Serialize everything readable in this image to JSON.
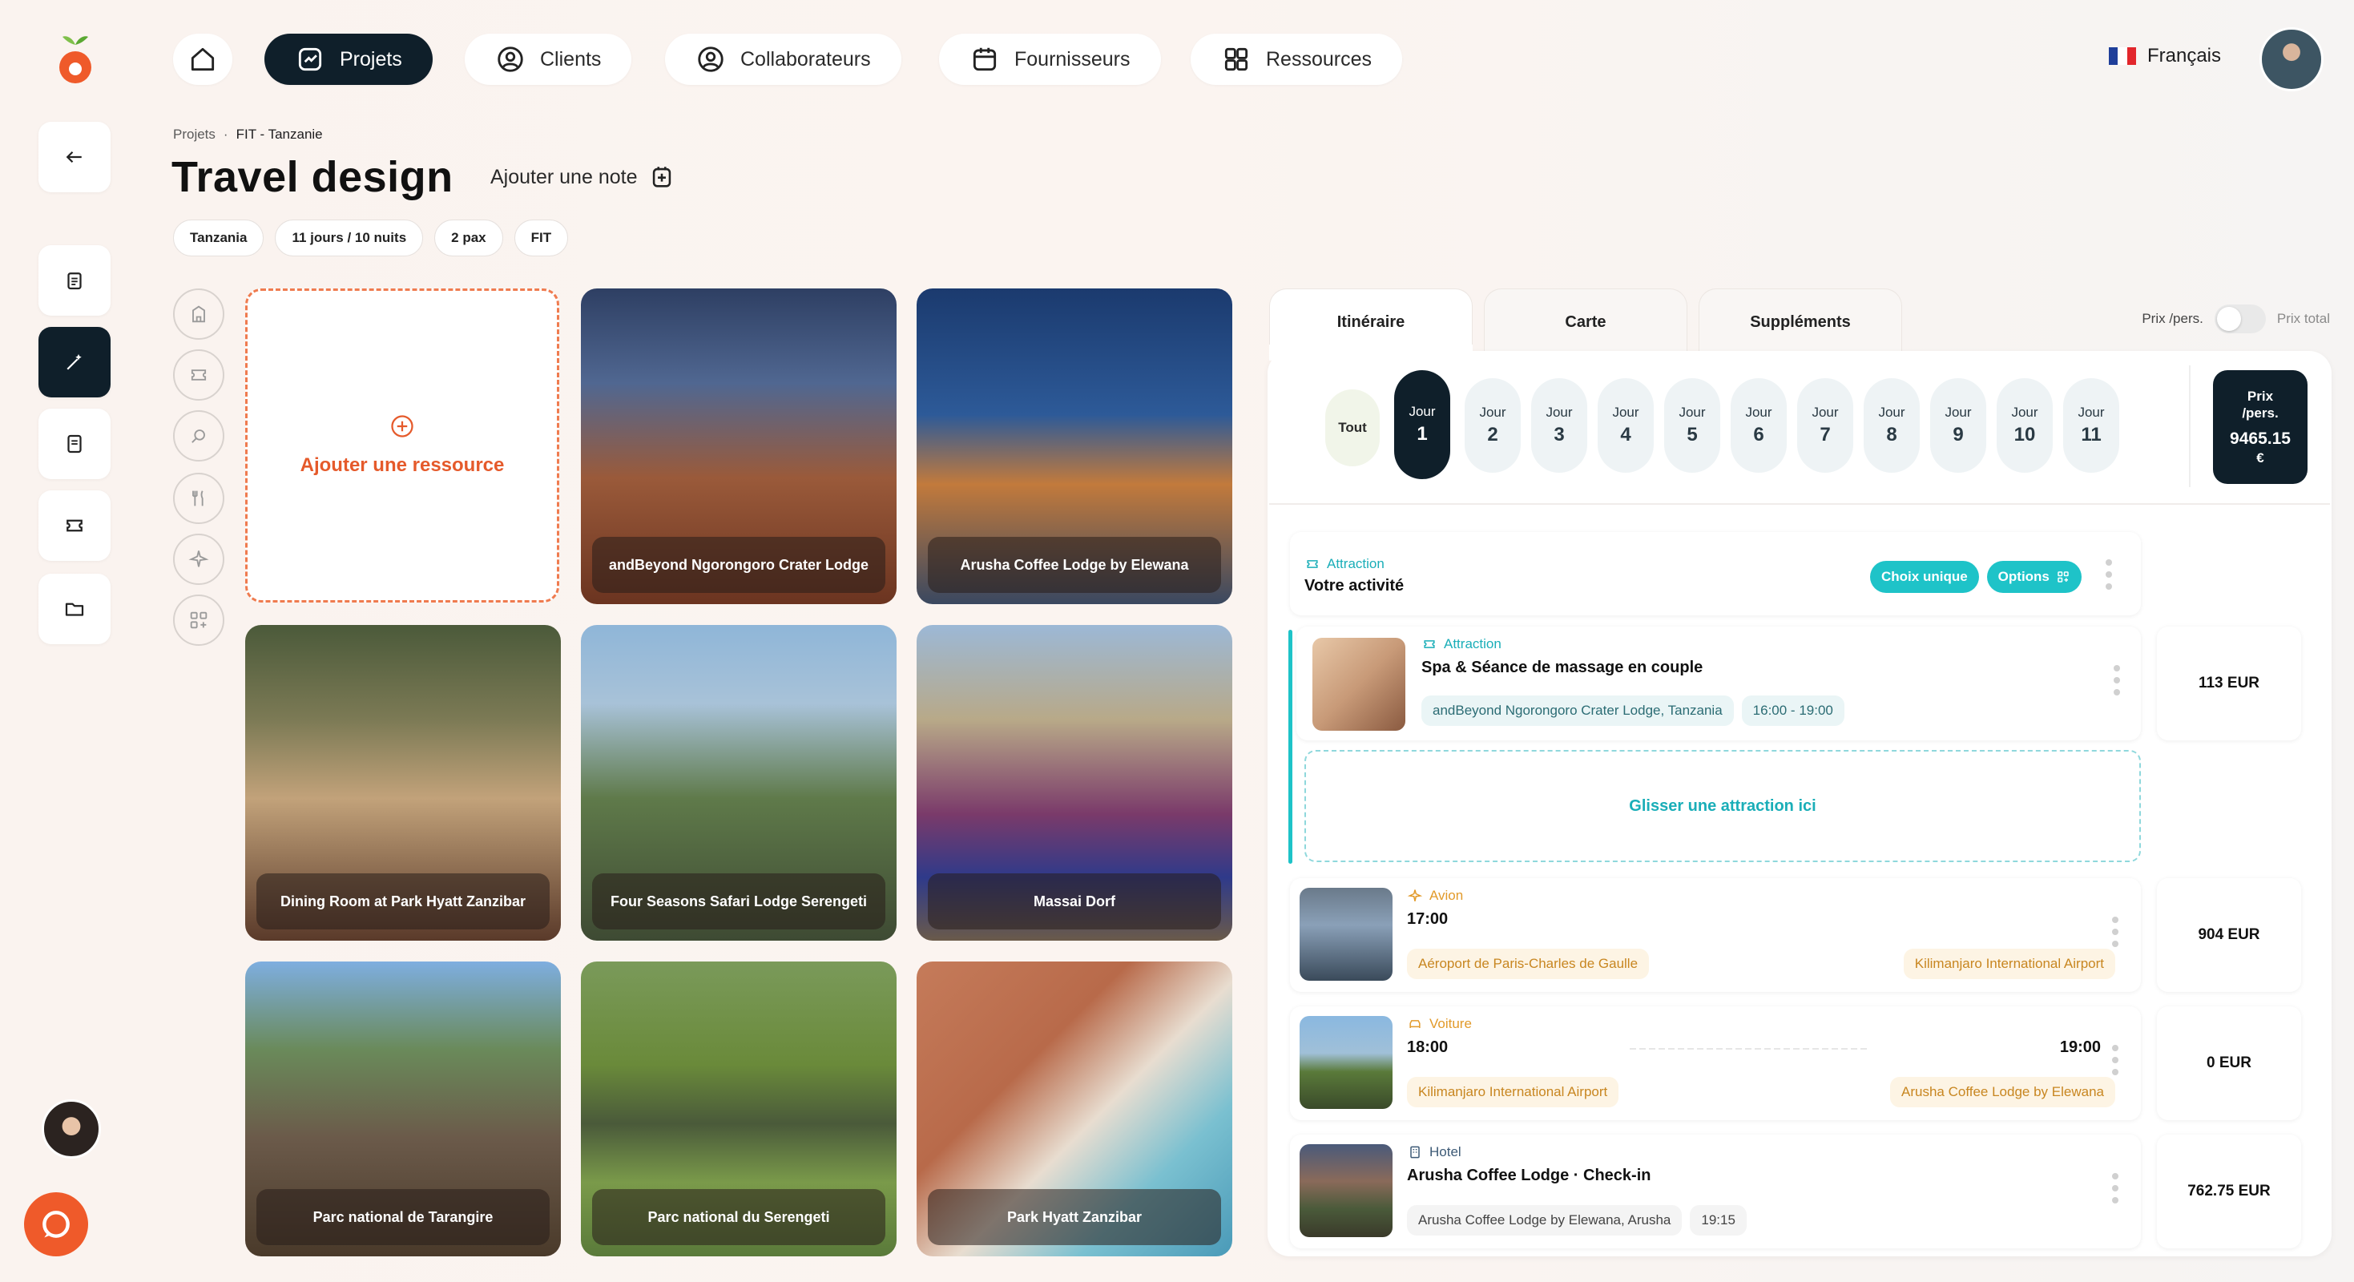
{
  "nav": {
    "items": [
      {
        "label": "Projets",
        "icon": "projects-icon",
        "active": true
      },
      {
        "label": "Clients",
        "icon": "user-circle-icon",
        "active": false
      },
      {
        "label": "Collaborateurs",
        "icon": "user-circle-icon",
        "active": false
      },
      {
        "label": "Fournisseurs",
        "icon": "calendar-icon",
        "active": false
      },
      {
        "label": "Ressources",
        "icon": "grid-icon",
        "active": false
      }
    ],
    "language": "Français"
  },
  "breadcrumb": {
    "root": "Projets",
    "separator": "·",
    "current": "FIT - Tanzanie"
  },
  "page": {
    "title": "Travel design",
    "add_note": "Ajouter une note",
    "tags": [
      "Tanzania",
      "11 jours / 10 nuits",
      "2 pax",
      "FIT"
    ]
  },
  "resources": {
    "add_label": "Ajouter une ressource",
    "cards": [
      "andBeyond Ngorongoro Crater Lodge",
      "Arusha Coffee Lodge by Elewana",
      "Dining Room at Park Hyatt Zanzibar",
      "Four Seasons Safari Lodge Serengeti",
      "Massai Dorf",
      "Parc national de Tarangire",
      "Parc national du Serengeti",
      "Park Hyatt Zanzibar"
    ]
  },
  "panel": {
    "tabs": [
      "Itinéraire",
      "Carte",
      "Suppléments"
    ],
    "toggle": {
      "left": "Prix /pers.",
      "right": "Prix total"
    },
    "days": {
      "all": "Tout",
      "day_label": "Jour",
      "numbers": [
        "1",
        "2",
        "3",
        "4",
        "5",
        "6",
        "7",
        "8",
        "9",
        "10",
        "11"
      ]
    },
    "price": {
      "label_1": "Prix",
      "label_2": "/pers.",
      "value": "9465.15",
      "currency": "€"
    },
    "activity": {
      "type": "Attraction",
      "title": "Votre activité",
      "choice_btn": "Choix unique",
      "options_btn": "Options"
    },
    "spa": {
      "type": "Attraction",
      "title": "Spa & Séance de massage en couple",
      "location": "andBeyond Ngorongoro Crater Lodge, Tanzania",
      "time": "16:00 - 19:00",
      "price": "113 EUR"
    },
    "drop_zone": "Glisser une attraction ici",
    "flight": {
      "type": "Avion",
      "time": "17:00",
      "from": "Aéroport de Paris-Charles de Gaulle",
      "to": "Kilimanjaro International Airport",
      "price": "904 EUR"
    },
    "car": {
      "type": "Voiture",
      "time_start": "18:00",
      "time_end": "19:00",
      "from": "Kilimanjaro International Airport",
      "to": "Arusha Coffee Lodge by Elewana",
      "price": "0 EUR"
    },
    "hotel": {
      "type": "Hotel",
      "title": "Arusha Coffee Lodge · Check-in",
      "location": "Arusha Coffee Lodge by Elewana, Arusha",
      "time": "19:15",
      "price": "762.75 EUR"
    }
  },
  "colors": {
    "accent": "#ef5a2a",
    "dark": "#0f1f2a",
    "teal": "#1ec3c8"
  }
}
